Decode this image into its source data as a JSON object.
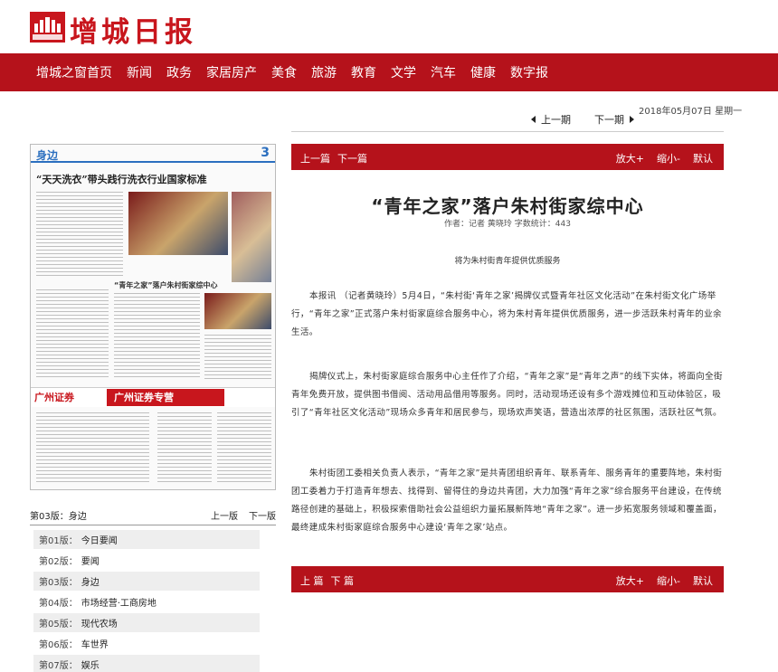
{
  "header": {
    "logo_text": "增城日报"
  },
  "nav": [
    "增城之窗首页",
    "新闻",
    "政务",
    "家居房产",
    "美食",
    "旅游",
    "教育",
    "文学",
    "汽车",
    "健康",
    "数字报"
  ],
  "date": "2018年05月07日 星期一",
  "top_pager": {
    "prev": "上一期",
    "next": "下一期"
  },
  "article_bar": {
    "prev": "上一篇",
    "next": "下一篇",
    "zoom_in": "放大+",
    "zoom_out": "缩小-",
    "default": "默认"
  },
  "article_bar_bottom": {
    "prev": "上 篇",
    "next": "下 篇",
    "zoom_in": "放大+",
    "zoom_out": "缩小-",
    "default": "默认"
  },
  "article": {
    "title": "“青年之家”落户朱村街家综中心",
    "meta": "作者：记者 黄晓玲  字数统计：443",
    "subtitle": "将为朱村街青年提供优质服务",
    "paragraphs": [
      "本报讯 （记者黄晓玲）5月4日，“朱村街‘青年之家’揭牌仪式暨青年社区文化活动”在朱村街文化广场举行，“青年之家”正式落户朱村街家庭综合服务中心，将为朱村青年提供优质服务，进一步活跃朱村青年的业余生活。",
      "揭牌仪式上，朱村街家庭综合服务中心主任作了介绍，“青年之家”是“青年之声”的线下实体，将面向全街青年免费开放，提供图书借阅、活动用品借用等服务。同时，活动现场还设有多个游戏摊位和互动体验区，吸引了“青年社区文化活动”现场众多青年和居民参与，现场欢声笑语，营造出浓厚的社区氛围，活跃社区气氛。",
      "朱村街团工委相关负责人表示，“青年之家”是共青团组织青年、联系青年、服务青年的重要阵地，朱村街团工委着力于打造青年想去、找得到、留得住的身边共青团，大力加强“青年之家”综合服务平台建设，在传统路径创建的基础上，积极探索借助社会公益组织力量拓展新阵地“青年之家”。进一步拓宽服务领域和覆盖面，最终建成朱村街家庭综合服务中心建设‘青年之家’站点。"
    ]
  },
  "newspaper_thumb": {
    "section": "身边",
    "page_number": "3",
    "headline": "“天天洗衣”带头践行洗衣行业国家标准",
    "caption_1": "“青年之家”落户朱村街家综中心",
    "caption_2": "广州证券",
    "caption_3": "广州证券专营"
  },
  "edition_bar": {
    "current": "第03版：身边",
    "prev": "上一版",
    "next": "下一版"
  },
  "editions": [
    {
      "page": "第01版：",
      "title": "今日要闻"
    },
    {
      "page": "第02版：",
      "title": "要闻"
    },
    {
      "page": "第03版：",
      "title": "身边"
    },
    {
      "page": "第04版：",
      "title": "市场经营·工商房地"
    },
    {
      "page": "第05版：",
      "title": "现代农场"
    },
    {
      "page": "第06版：",
      "title": "车世界"
    },
    {
      "page": "第07版：",
      "title": "娱乐"
    }
  ],
  "colors": {
    "brand_red": "#b5121b",
    "logo_red": "#c8161d"
  }
}
